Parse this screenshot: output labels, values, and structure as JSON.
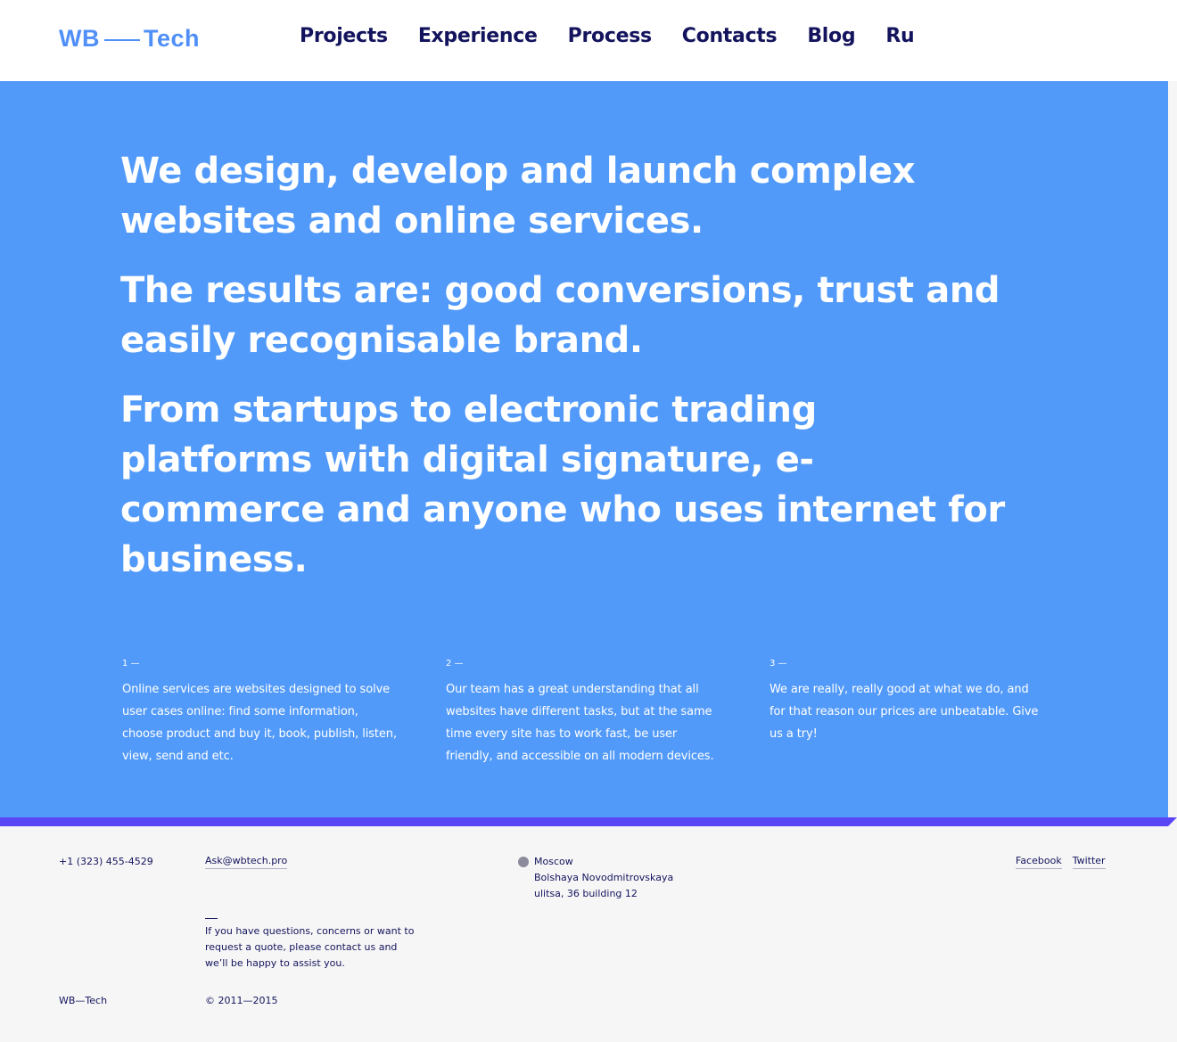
{
  "header": {
    "logo_left": "WB",
    "logo_right": "Tech",
    "nav": [
      "Projects",
      "Experience",
      "Process",
      "Contacts",
      "Blog",
      "Ru"
    ]
  },
  "hero": {
    "lines": [
      "We design, develop and launch complex websites and online services.",
      "The results are: good conversions, trust and easily recognisable brand.",
      "From startups to electronic trading platforms with digital signature, e-commerce and anyone who uses internet for business."
    ],
    "features": [
      {
        "num": "1 —",
        "text": "Online services are websites designed to solve user cases online: find some information, choose product and buy it, book, publish, listen, view, send and etc."
      },
      {
        "num": "2 —",
        "text": "Our team has a great understanding that all websites have different tasks, but at the same time every site has to work fast, be user friendly, and accessible on all modern devices."
      },
      {
        "num": "3 —",
        "text": "We are really, really good at what we do, and for that reason our prices are unbeatable. Give us a try!"
      }
    ]
  },
  "footer": {
    "phone": "+1 (323) 455-4529",
    "email": "Ask@wbtech.pro",
    "address": [
      "Moscow",
      "Bolshaya Novodmitrovskaya",
      "ulitsa, 36 building 12"
    ],
    "social": [
      "Facebook",
      "Twitter"
    ],
    "questions": "If you have questions, concerns or want to request a quote, please contact us and we’ll be happy to assist you.",
    "brand": "WB—Tech",
    "copyright": "© 2011—2015"
  },
  "colors": {
    "accent": "#4f8ff7",
    "hero_bg": "#529af9",
    "stripe": "#5b46f5",
    "nav_text": "#14145e",
    "footer_bg": "#f6f6f6"
  }
}
